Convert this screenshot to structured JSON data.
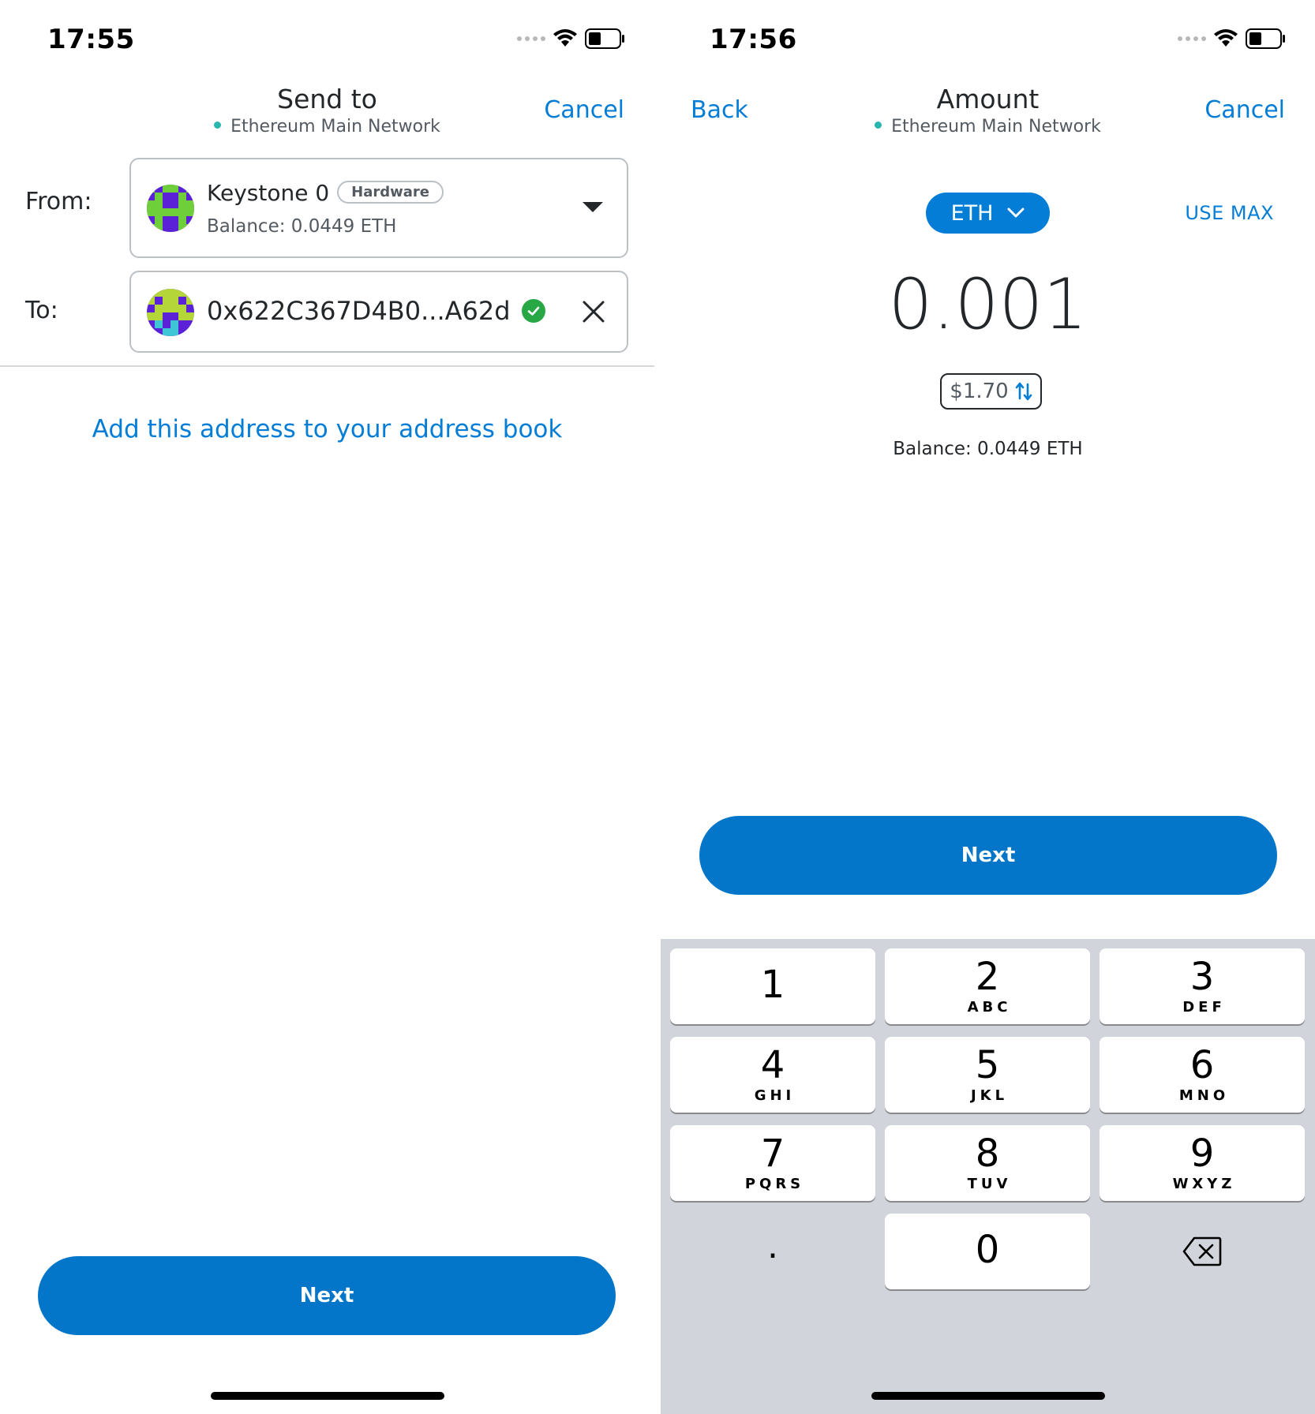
{
  "left": {
    "status_time": "17:55",
    "title": "Send to",
    "network": "Ethereum Main Network",
    "cancel": "Cancel",
    "from_label": "From:",
    "from_account": {
      "name": "Keystone 0",
      "badge": "Hardware",
      "balance": "Balance: 0.0449 ETH"
    },
    "to_label": "To:",
    "to_address": "0x622C367D4B0...A62d",
    "add_address_link": "Add this address to your address book",
    "next": "Next"
  },
  "right": {
    "status_time": "17:56",
    "back": "Back",
    "title": "Amount",
    "network": "Ethereum Main Network",
    "cancel": "Cancel",
    "token": "ETH",
    "use_max": "USE MAX",
    "amount": "0.001",
    "fiat": "$1.70",
    "balance": "Balance: 0.0449 ETH",
    "next": "Next",
    "keypad": [
      {
        "digit": "1",
        "letters": ""
      },
      {
        "digit": "2",
        "letters": "ABC"
      },
      {
        "digit": "3",
        "letters": "DEF"
      },
      {
        "digit": "4",
        "letters": "GHI"
      },
      {
        "digit": "5",
        "letters": "JKL"
      },
      {
        "digit": "6",
        "letters": "MNO"
      },
      {
        "digit": "7",
        "letters": "PQRS"
      },
      {
        "digit": "8",
        "letters": "TUV"
      },
      {
        "digit": "9",
        "letters": "WXYZ"
      },
      {
        "digit": ".",
        "letters": ""
      },
      {
        "digit": "0",
        "letters": ""
      }
    ]
  },
  "icons": {
    "signal": "cellular-signal-icon",
    "wifi": "wifi-icon",
    "battery": "battery-icon",
    "dropdown": "caret-down-icon",
    "verified": "check-circle-icon",
    "clear": "close-icon",
    "token_dropdown": "chevron-down-icon",
    "swap": "swap-vertical-icon",
    "backspace": "backspace-icon"
  },
  "colors": {
    "primary": "#037DD6",
    "button": "#0376C9",
    "network_dot": "#29B6AF",
    "verified": "#28A745",
    "keypad_bg": "#D1D4DA"
  }
}
